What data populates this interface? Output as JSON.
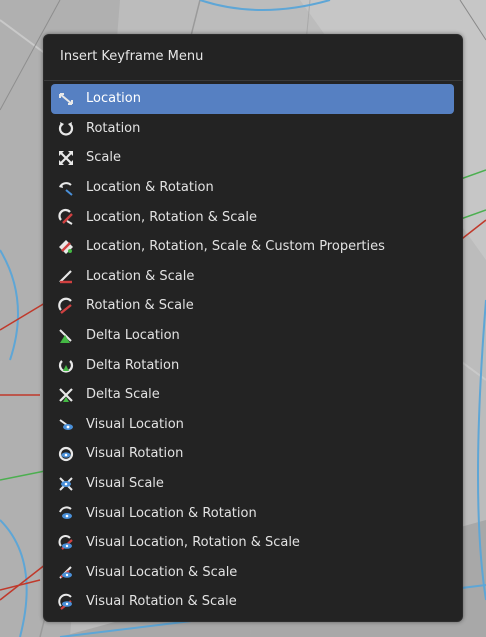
{
  "menu": {
    "title": "Insert Keyframe Menu",
    "items": [
      {
        "label": "Location",
        "icon": "location-icon",
        "active": true
      },
      {
        "label": "Rotation",
        "icon": "rotation-icon"
      },
      {
        "label": "Scale",
        "icon": "scale-icon"
      },
      {
        "label": "Location & Rotation",
        "icon": "location-rotation-icon"
      },
      {
        "label": "Location, Rotation & Scale",
        "icon": "location-rotation-scale-icon"
      },
      {
        "label": "Location, Rotation, Scale & Custom Properties",
        "icon": "location-rotation-scale-custom-icon"
      },
      {
        "label": "Location & Scale",
        "icon": "location-scale-icon"
      },
      {
        "label": "Rotation & Scale",
        "icon": "rotation-scale-icon"
      },
      {
        "label": "Delta Location",
        "icon": "delta-location-icon"
      },
      {
        "label": "Delta Rotation",
        "icon": "delta-rotation-icon"
      },
      {
        "label": "Delta Scale",
        "icon": "delta-scale-icon"
      },
      {
        "label": "Visual Location",
        "icon": "visual-location-icon"
      },
      {
        "label": "Visual Rotation",
        "icon": "visual-rotation-icon"
      },
      {
        "label": "Visual Scale",
        "icon": "visual-scale-icon"
      },
      {
        "label": "Visual Location & Rotation",
        "icon": "visual-location-rotation-icon"
      },
      {
        "label": "Visual Location, Rotation & Scale",
        "icon": "visual-location-rotation-scale-icon"
      },
      {
        "label": "Visual Location & Scale",
        "icon": "visual-location-scale-icon"
      },
      {
        "label": "Visual Rotation & Scale",
        "icon": "visual-rotation-scale-icon"
      }
    ]
  },
  "colors": {
    "menu_bg": "#232323",
    "highlight": "#5680c2",
    "text": "#e2e2e2",
    "viewport_bg": "#b9b9b9"
  }
}
